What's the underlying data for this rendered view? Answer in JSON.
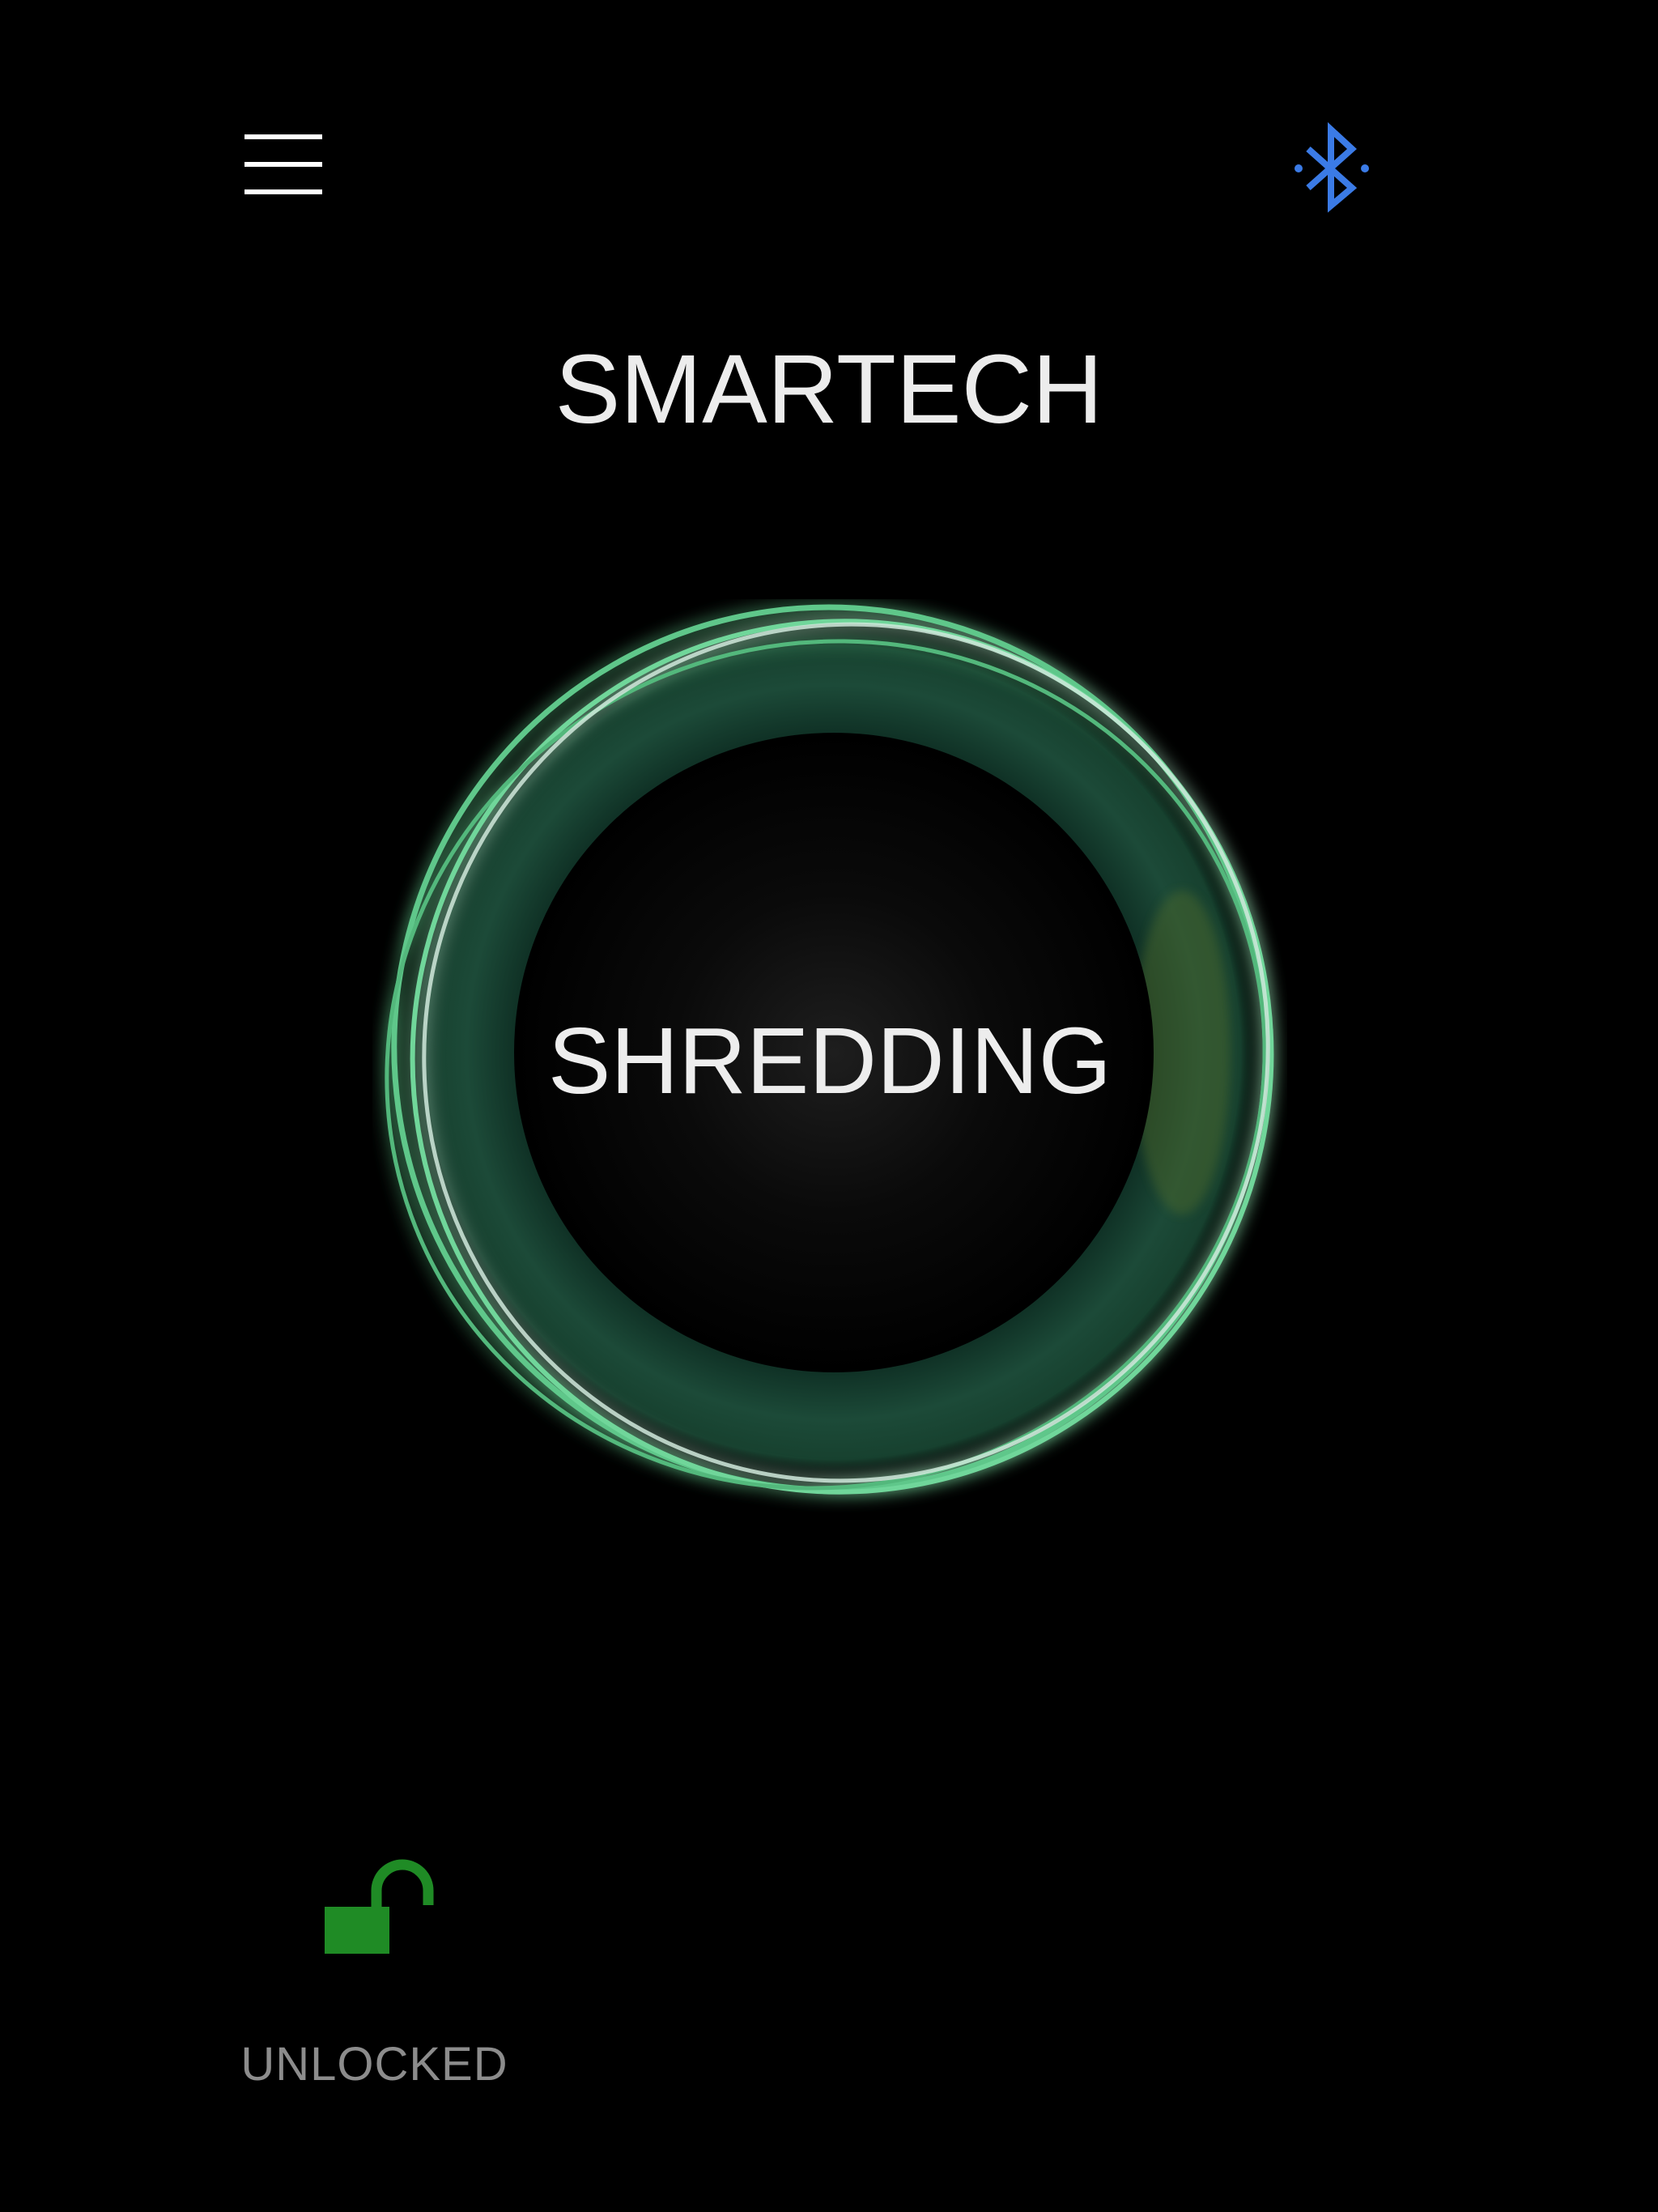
{
  "header": {
    "title": "SMARTECH",
    "menu_icon": "hamburger-menu-icon",
    "bluetooth_icon": "bluetooth-icon"
  },
  "main": {
    "status": "SHREDDING"
  },
  "lock": {
    "icon": "unlocked-padlock-icon",
    "label": "UNLOCKED"
  },
  "colors": {
    "background": "#000000",
    "ring_green": "#5ec78a",
    "bluetooth_blue": "#3b7be6",
    "lock_green": "#1f8b25",
    "label_gray": "#8c8c8c"
  }
}
